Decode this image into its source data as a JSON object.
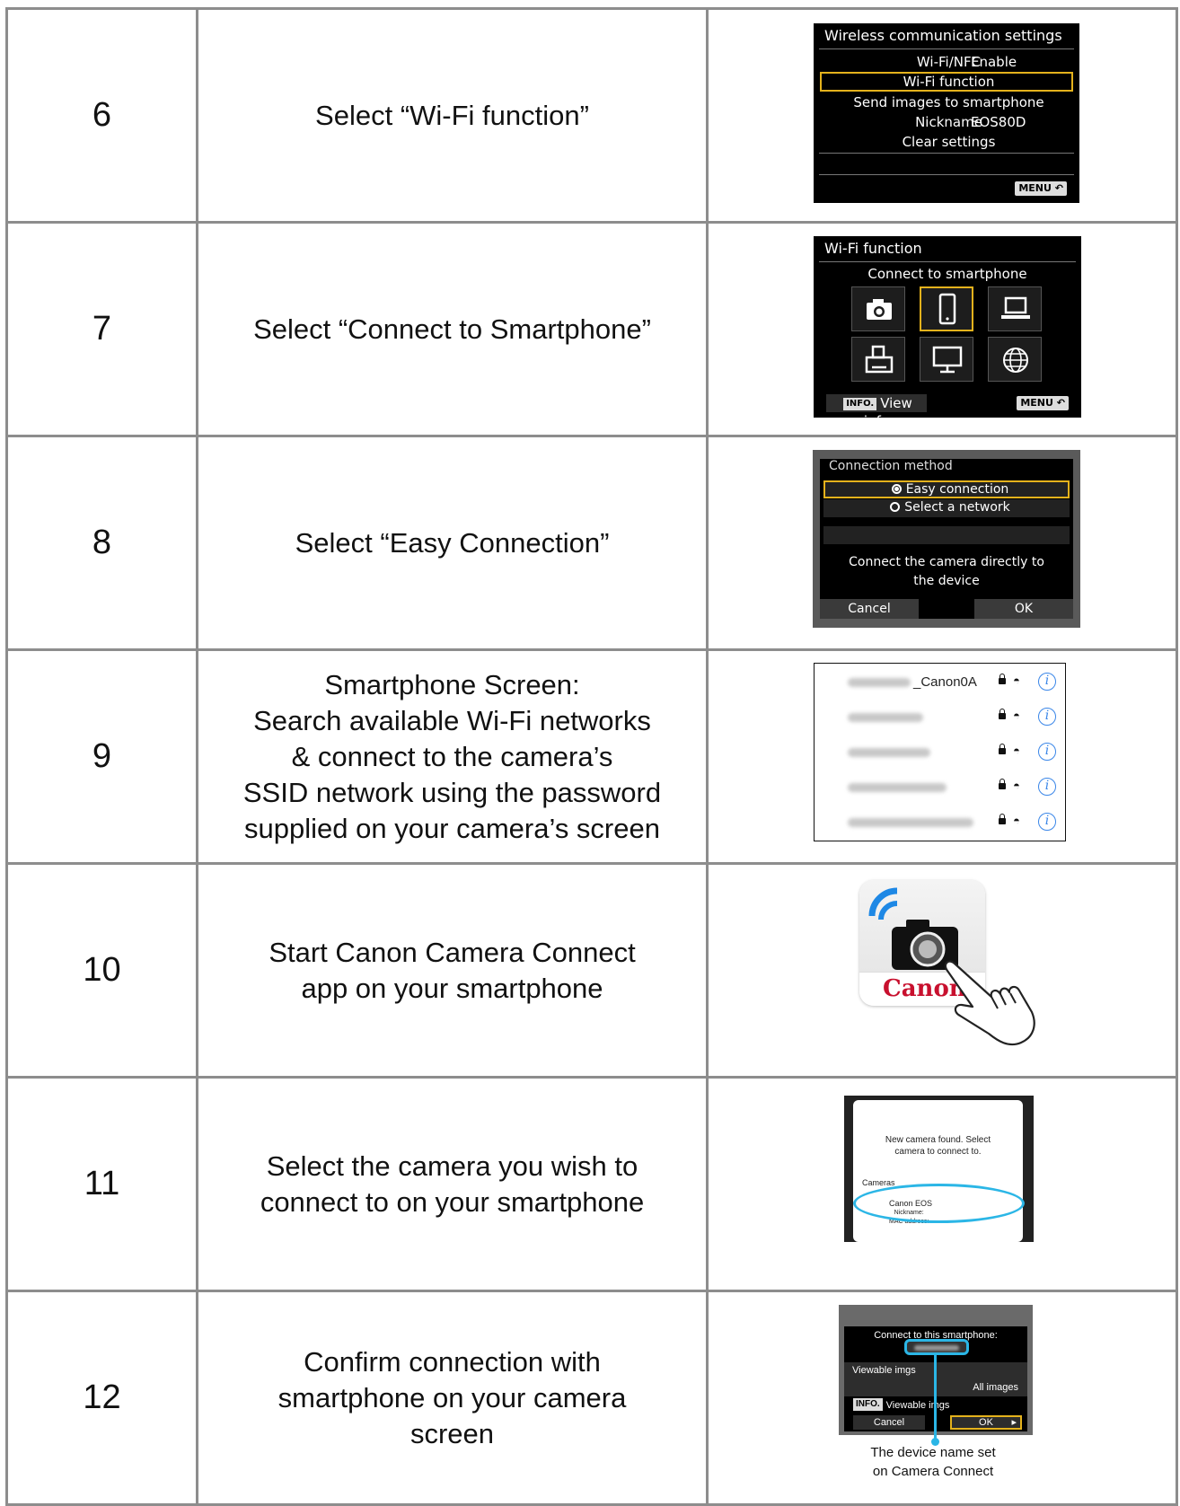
{
  "steps": [
    {
      "number": "6",
      "text": "Select “Wi-Fi function”"
    },
    {
      "number": "7",
      "text": "Select “Connect to Smartphone”"
    },
    {
      "number": "8",
      "text": "Select “Easy Connection”"
    },
    {
      "number": "9",
      "text": "Smartphone Screen:\nSearch available Wi-Fi networks\n& connect to the camera’s\nSSID network using the password\nsupplied on your camera’s screen"
    },
    {
      "number": "10",
      "text": "Start Canon Camera Connect\napp on your smartphone"
    },
    {
      "number": "11",
      "text": "Select the camera you wish to\nconnect to on your smartphone"
    },
    {
      "number": "12",
      "text": "Confirm connection with\nsmartphone on your camera\nscreen"
    }
  ],
  "screen_wireless": {
    "title": "Wireless communication settings",
    "rows": [
      {
        "label": "Wi-Fi/NFC",
        "value": "Enable"
      },
      {
        "label": "Wi-Fi function",
        "value": ""
      },
      {
        "label": "Send images to smartphone",
        "value": ""
      },
      {
        "label": "Nickname",
        "value": "EOS80D"
      },
      {
        "label": "Clear settings",
        "value": ""
      }
    ],
    "highlighted_row": "Wi-Fi function",
    "menu_label": "MENU"
  },
  "screen_wifi_function": {
    "title": "Wi-Fi function",
    "subtitle": "Connect to smartphone",
    "icons": [
      "camera-icon",
      "smartphone-icon",
      "computer-icon",
      "printer-icon",
      "monitor-icon",
      "globe-icon"
    ],
    "selected_icon": "smartphone-icon",
    "info_badge": "INFO.",
    "info_label": "View info",
    "menu_label": "MENU"
  },
  "screen_connection_method": {
    "title": "Connection method",
    "options": [
      "Easy connection",
      "Select a network"
    ],
    "selected_option": "Easy connection",
    "message": "Connect the camera directly to\nthe device",
    "cancel_label": "Cancel",
    "ok_label": "OK"
  },
  "screen_networks": {
    "networks": [
      "_Canon0A",
      "",
      "",
      "",
      ""
    ]
  },
  "app_icon": {
    "brand": "Canon"
  },
  "screen_camera_found": {
    "message": "New camera found. Select\ncamera to connect to.",
    "section": "Cameras",
    "model": "Canon EOS",
    "details": "Nickname:\nMAC address:"
  },
  "screen_confirm": {
    "header": "Connect to this smartphone:",
    "viewable_label": "Viewable imgs",
    "all_images": "All images",
    "info_badge": "INFO.",
    "info_label": "Viewable imgs",
    "cancel_label": "Cancel",
    "ok_label": "OK",
    "caption": "The device name set\non Camera Connect"
  }
}
